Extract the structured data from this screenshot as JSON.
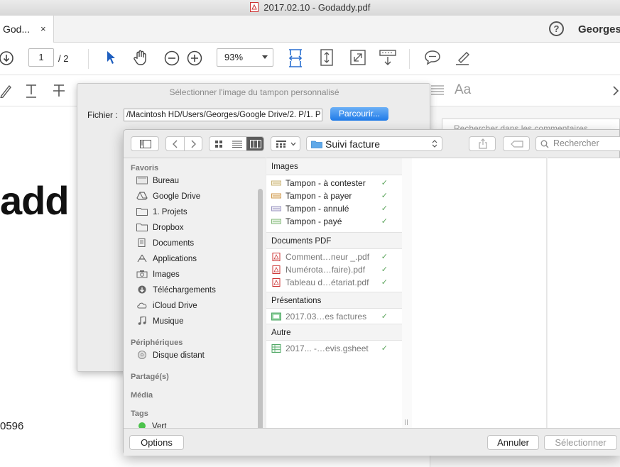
{
  "window": {
    "title": "2017.02.10 - Godaddy.pdf"
  },
  "tabs": [
    {
      "label": "God...",
      "close": "×"
    }
  ],
  "header": {
    "help": "?",
    "user": "Georges"
  },
  "toolbar": {
    "page_current": "1",
    "page_total": "/ 2",
    "zoom": "93%"
  },
  "toolbar2": {
    "font_label": "Aa"
  },
  "right_panel": {
    "search_placeholder": "Rechercher dans les commentaires"
  },
  "document": {
    "logo_text": "add",
    "number_text": "0596"
  },
  "stamp_dialog": {
    "title": "Sélectionner l'image du tampon personnalisé",
    "file_label": "Fichier :",
    "file_path": "/Macintosh HD/Users/Georges/Google Drive/2. P/1. P",
    "browse_button": "Parcourir..."
  },
  "file_dialog": {
    "location": "Suivi facture",
    "search_placeholder": "Rechercher",
    "sidebar": {
      "favorites_title": "Favoris",
      "favorites": [
        "Bureau",
        "Google Drive",
        "1. Projets",
        "Dropbox",
        "Documents",
        "Applications",
        "Images",
        "Téléchargements",
        "iCloud Drive",
        "Musique"
      ],
      "devices_title": "Périphériques",
      "devices": [
        "Disque distant"
      ],
      "shared_title": "Partagé(s)",
      "media_title": "Média",
      "tags_title": "Tags",
      "tags": [
        "Vert"
      ]
    },
    "groups": [
      {
        "title": "Images",
        "items": [
          "Tampon - à contester",
          "Tampon - à payer",
          "Tampon - annulé",
          "Tampon - payé"
        ]
      },
      {
        "title": "Documents PDF",
        "items": [
          "Comment…neur _.pdf",
          "Numérota…faire).pdf",
          "Tableau d…étariat.pdf"
        ]
      },
      {
        "title": "Présentations",
        "items": [
          "2017.03…es factures"
        ]
      },
      {
        "title": "Autre",
        "items": [
          "2017... -…evis.gsheet"
        ]
      }
    ],
    "options_button": "Options",
    "cancel_button": "Annuler",
    "select_button": "Sélectionner"
  },
  "colors": {
    "accent": "#1f7ae8",
    "check": "#5aa45a",
    "folder": "#5fa8e8"
  }
}
